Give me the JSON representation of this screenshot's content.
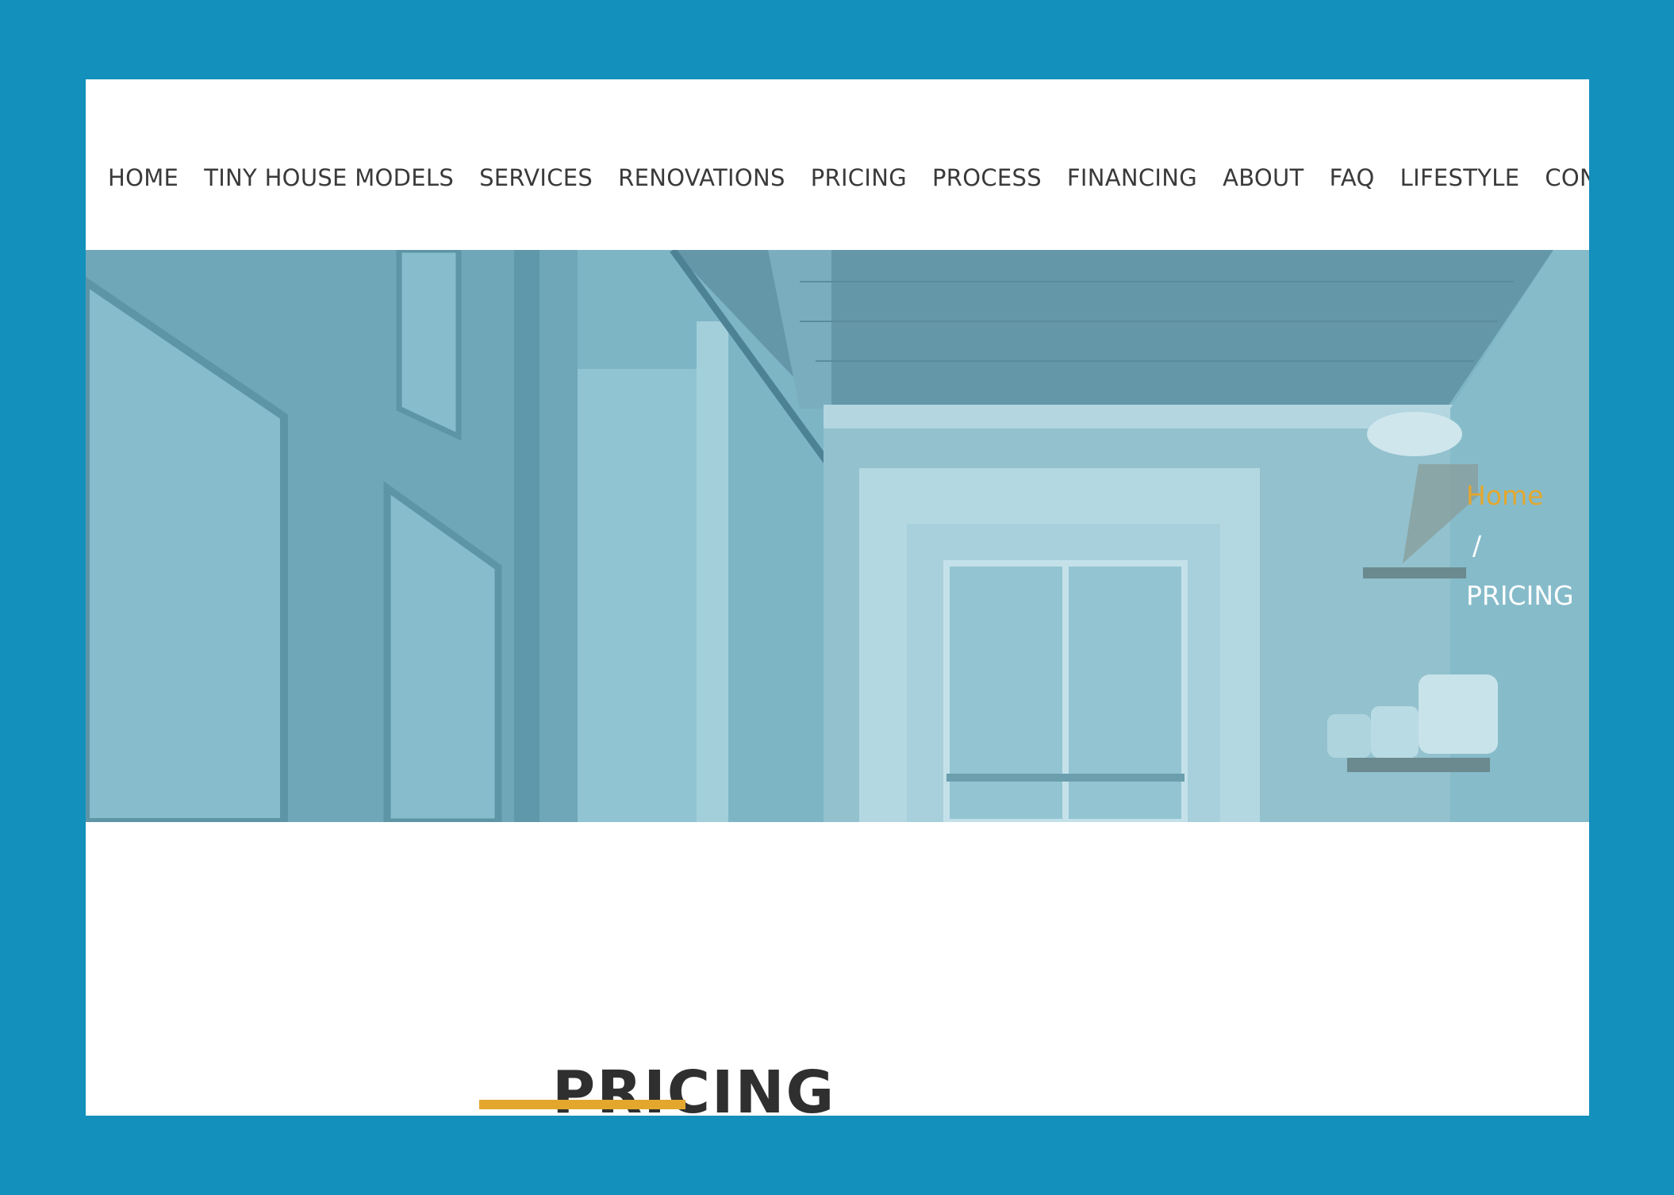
{
  "nav": {
    "items": [
      {
        "label": "HOME"
      },
      {
        "label": "TINY HOUSE MODELS"
      },
      {
        "label": "SERVICES"
      },
      {
        "label": "RENOVATIONS"
      },
      {
        "label": "PRICING"
      },
      {
        "label": "PROCESS"
      },
      {
        "label": "FINANCING"
      },
      {
        "label": "ABOUT"
      },
      {
        "label": "FAQ"
      },
      {
        "label": "LIFESTYLE"
      },
      {
        "label": "CONTACT"
      }
    ]
  },
  "breadcrumb": {
    "home": "Home",
    "separator": "/",
    "current": "PRICING"
  },
  "main": {
    "title": "PRICING"
  },
  "colors": {
    "page_background": "#1390bb",
    "accent": "#e3a72e",
    "hero_overlay": "#7fb7c7",
    "nav_text": "#3a3a3a",
    "title_text": "#2f2f2f"
  }
}
